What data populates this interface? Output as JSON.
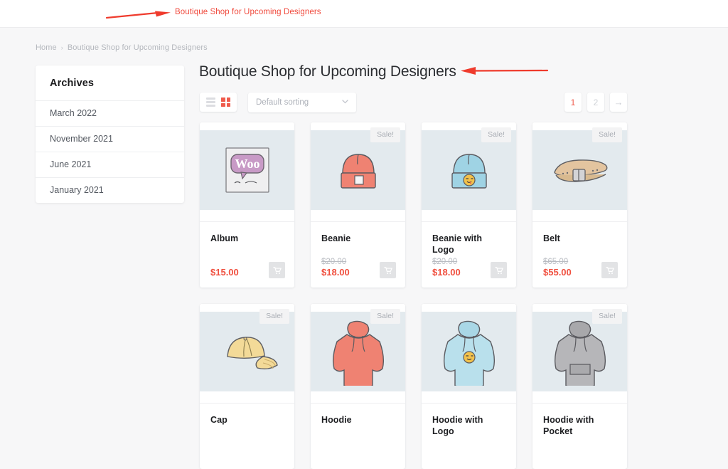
{
  "annotations": {
    "top_label": "Boutique Shop for Upcoming Designers",
    "arrow_color": "#ef3b2d"
  },
  "breadcrumb": {
    "home": "Home",
    "separator": "›",
    "current": "Boutique Shop for Upcoming Designers"
  },
  "sidebar": {
    "title": "Archives",
    "items": [
      {
        "label": "March 2022"
      },
      {
        "label": "November 2021"
      },
      {
        "label": "June 2021"
      },
      {
        "label": "January 2021"
      }
    ]
  },
  "main": {
    "page_title": "Boutique Shop for Upcoming Designers"
  },
  "toolbar": {
    "list_view_icon": "list-view-icon",
    "grid_view_icon": "grid-view-icon",
    "sorting_value": "Default sorting",
    "chevron": "⌄",
    "accent_color": "#ef5a4b"
  },
  "pagination": {
    "pages": [
      {
        "label": "1",
        "active": true
      },
      {
        "label": "2",
        "active": false
      }
    ],
    "next_label": "→"
  },
  "products": [
    {
      "name": "Album",
      "sale": false,
      "badge": "",
      "price_old": "",
      "price_new": "$15.00",
      "cart_icon": "cart-icon",
      "image": "woo-album"
    },
    {
      "name": "Beanie",
      "sale": true,
      "badge": "Sale!",
      "price_old": "$20.00",
      "price_new": "$18.00",
      "cart_icon": "cart-icon",
      "image": "beanie-red"
    },
    {
      "name": "Beanie with Logo",
      "sale": true,
      "badge": "Sale!",
      "price_old": "$20.00",
      "price_new": "$18.00",
      "cart_icon": "cart-icon",
      "image": "beanie-blue-logo"
    },
    {
      "name": "Belt",
      "sale": true,
      "badge": "Sale!",
      "price_old": "$65.00",
      "price_new": "$55.00",
      "cart_icon": "cart-icon",
      "image": "belt-tan"
    },
    {
      "name": "Cap",
      "sale": true,
      "badge": "Sale!",
      "price_old": "",
      "price_new": "",
      "cart_icon": "cart-icon",
      "image": "cap-yellow"
    },
    {
      "name": "Hoodie",
      "sale": true,
      "badge": "Sale!",
      "price_old": "",
      "price_new": "",
      "cart_icon": "cart-icon",
      "image": "hoodie-red"
    },
    {
      "name": "Hoodie with Logo",
      "sale": false,
      "badge": "",
      "price_old": "",
      "price_new": "",
      "cart_icon": "cart-icon",
      "image": "hoodie-blue-logo"
    },
    {
      "name": "Hoodie with Pocket",
      "sale": true,
      "badge": "Sale!",
      "price_old": "",
      "price_new": "",
      "cart_icon": "cart-icon",
      "image": "hoodie-gray"
    }
  ]
}
